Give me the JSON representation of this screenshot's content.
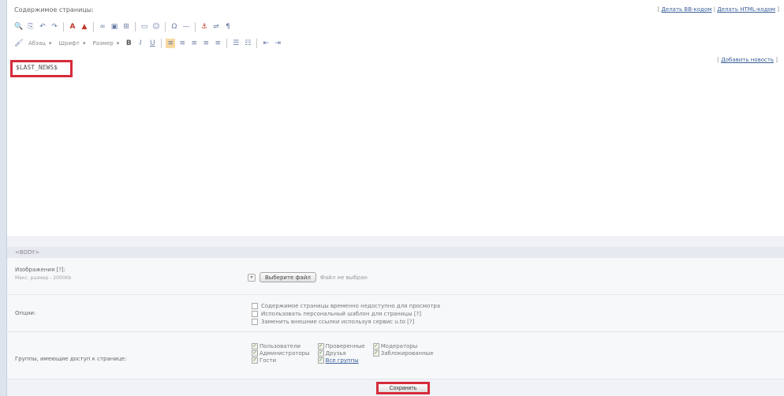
{
  "header": {
    "title": "Содержимое страницы:",
    "link_bb": "Делать BB-кодом",
    "link_html": "Делать HTML-кодом"
  },
  "toolbar1": {
    "icons": [
      "search-icon",
      "copy-icon",
      "undo-icon",
      "redo-icon",
      "font-color-icon",
      "bg-color-icon",
      "link-icon",
      "image-icon",
      "table-icon",
      "flash-icon",
      "smile-icon",
      "pagebreak-icon",
      "hr-icon",
      "anchor-icon",
      "source-icon",
      "special-char-icon"
    ]
  },
  "toolbar2": {
    "paragraph": "Абзац",
    "font": "Шрифт",
    "size": "Размер"
  },
  "editor": {
    "content": "$LAST_NEWS$",
    "add_news": "Добавить новость"
  },
  "body_tag": "<BODY>",
  "images": {
    "label": "Изображения [?]:",
    "sublabel": "Макс. размер - 2000Kb",
    "choose_file": "Выберите файл",
    "file_status": "Файл не выбран"
  },
  "options": {
    "label": "Опции:",
    "items": [
      {
        "text": "Содержимое страницы временно недоступно для просмотра",
        "checked": false
      },
      {
        "text": "Использовать персональный шаблон для страницы [?]",
        "checked": false
      },
      {
        "text": "Заменить внешние ссылки используя сервис u.to [?]",
        "checked": false
      }
    ]
  },
  "groups": {
    "label": "Группы, имеющие доступ к странице:",
    "col1": [
      "Пользователи",
      "Администраторы",
      "Гости"
    ],
    "col2": [
      "Проверенные",
      "Друзья"
    ],
    "col2_link": "Все группы",
    "col3": [
      "Модераторы",
      "Заблокированные"
    ]
  },
  "save_label": "Сохранить"
}
